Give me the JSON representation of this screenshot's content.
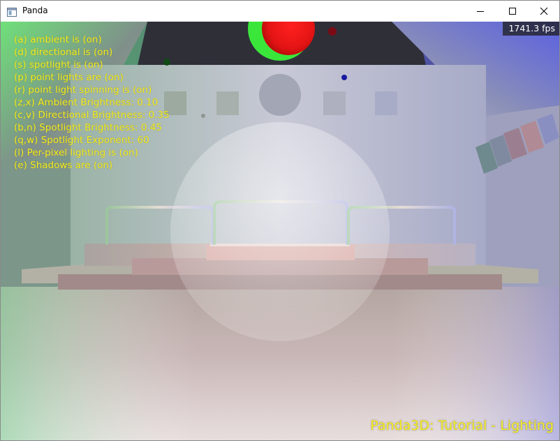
{
  "window": {
    "title": "Panda"
  },
  "help_lines": [
    "(a) ambient is (on)",
    "(d) directional is (on)",
    "(s) spotlight is (on)",
    "(p) point lights are (on)",
    "(r) point light spinning is (on)",
    "(z,x) Ambient Brightness: 0.10",
    "(c,v) Directional Brightness: 0.35",
    "(b,n) Spotlight Brightness: 0.45",
    "(q,w) Spotlight Exponent: 60",
    "(l) Per-pixel lighting is (on)",
    "(e) Shadows are (on)"
  ],
  "fps_text": "1741.3 fps",
  "caption": "Panda3D: Tutorial - Lighting",
  "icons": {
    "app": "window-app-icon",
    "minimize": "minimize-icon",
    "maximize": "maximize-icon",
    "close": "close-icon"
  },
  "colors": {
    "overlay_text": "#f5ef22",
    "fps_background": "#1e1e1e"
  }
}
